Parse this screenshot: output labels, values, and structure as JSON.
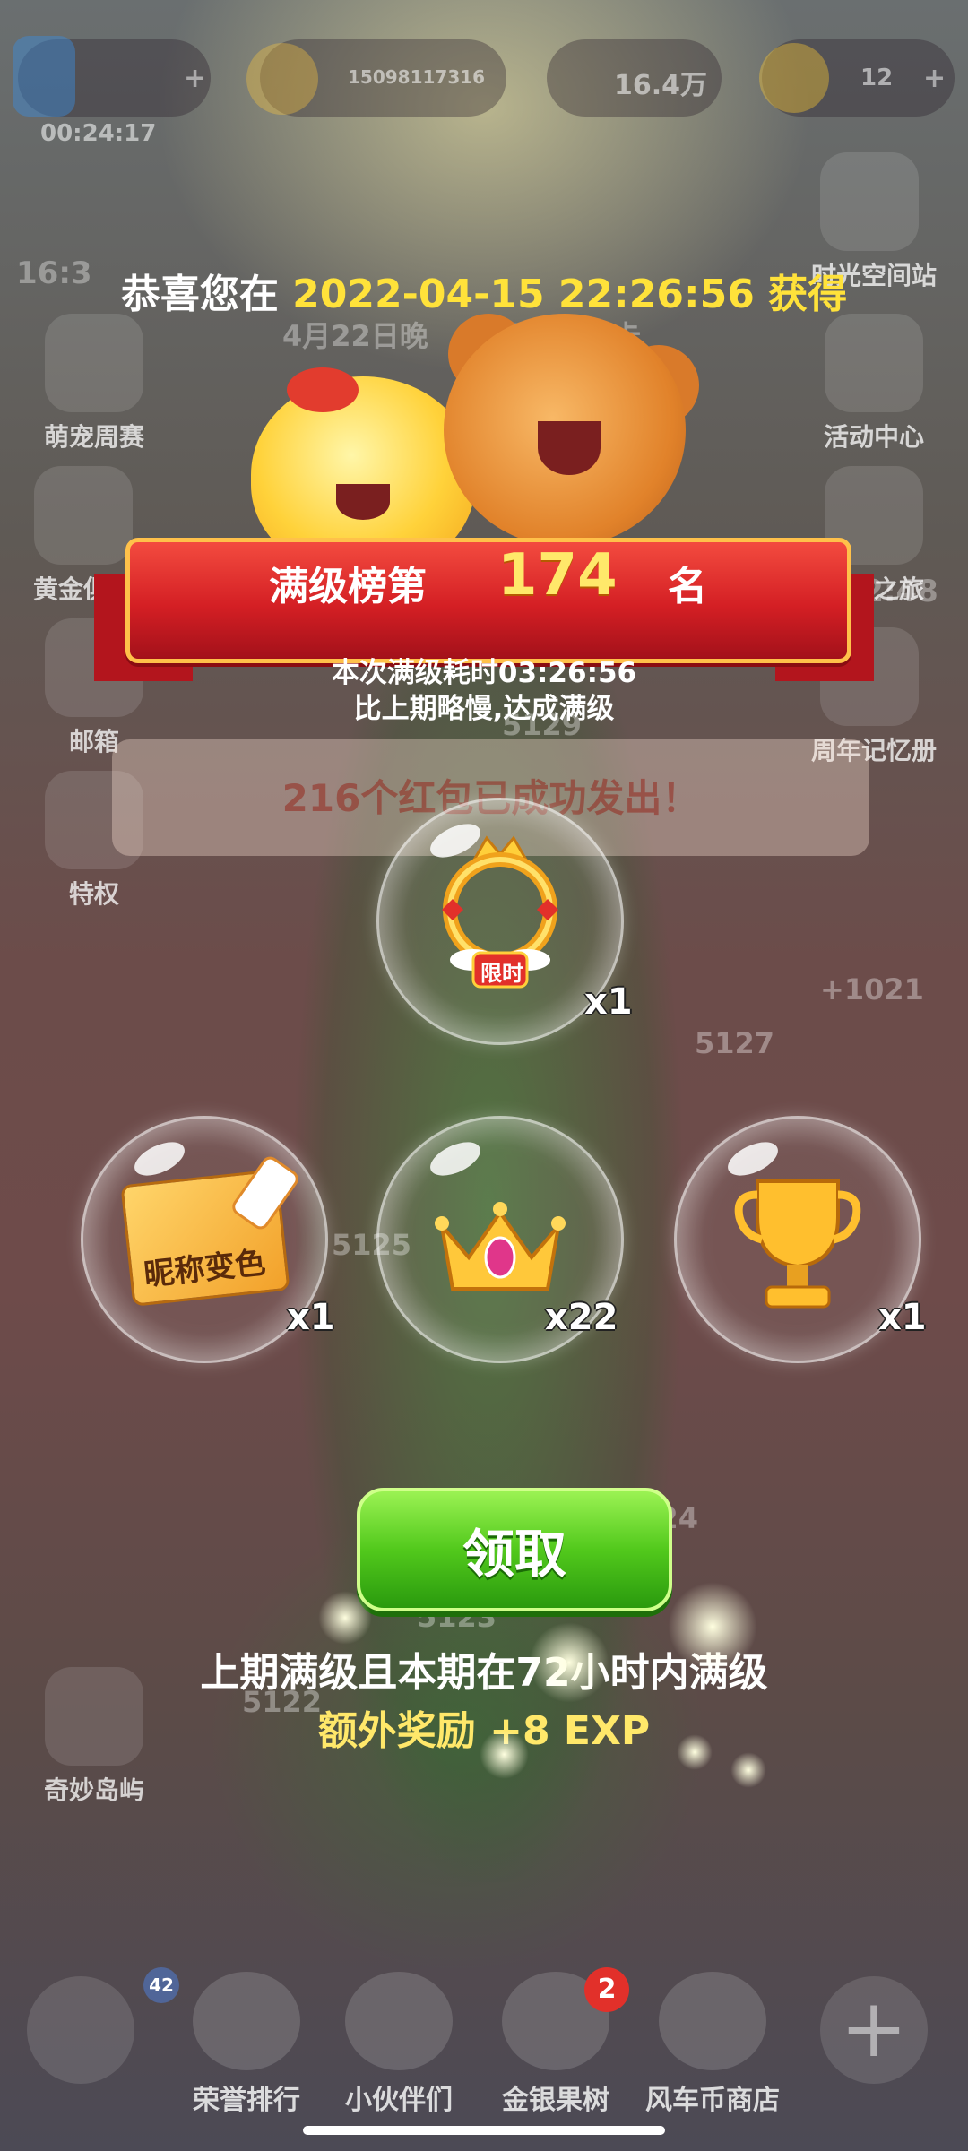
{
  "hud": {
    "energy_timer": "00:24:17",
    "star_id": "15098117316",
    "coins": "16.4万",
    "red_packets": "12"
  },
  "background": {
    "side_left": [
      "萌宠周赛",
      "黄金俱乐",
      "邮箱",
      "特权",
      "奇妙岛屿"
    ],
    "side_right": [
      "时光空间站",
      "活动中心",
      "寻忆之旅",
      "周年记忆册"
    ],
    "timer_left": "16:3",
    "timer_right": ":32:48",
    "event_note": "4月22日晚",
    "event_note_tail": "开启新关卡",
    "level_numbers": [
      "5129",
      "5127",
      "5125",
      "5124",
      "5123",
      "5122"
    ],
    "bonus_score": "+1021"
  },
  "dialog": {
    "congrats_prefix": "恭喜您在",
    "congrats_date": "2022-04-15 22:26:56",
    "congrats_suffix": "获得",
    "rank_label": "满级榜第",
    "rank_value": "174",
    "rank_suffix": "名",
    "time_used": "本次满级耗时03:26:56",
    "compare": "比上期略慢,达成满级",
    "banner": "216个红包已成功发出！",
    "rewards": [
      {
        "icon": "gold-avatar-frame-icon",
        "tag": "限时",
        "qty": "x1"
      },
      {
        "icon": "nickname-color-card-icon",
        "label": "昵称变色",
        "qty": "x1"
      },
      {
        "icon": "crown-icon",
        "qty": "x22"
      },
      {
        "icon": "gold-trophy-icon",
        "qty": "x1"
      }
    ],
    "claim_label": "领取",
    "note_line1": "上期满级且本期在72小时内满级",
    "note_line2": "额外奖励 +8 EXP"
  },
  "nav": {
    "items": [
      "荣誉排行",
      "小伙伴们",
      "金银果树",
      "风车币商店"
    ],
    "fruit_badge": "2",
    "rank_badge": "42"
  },
  "colors": {
    "ribbon": "#d41f24",
    "claim": "#52c91c",
    "highlight": "#ffe23a"
  }
}
